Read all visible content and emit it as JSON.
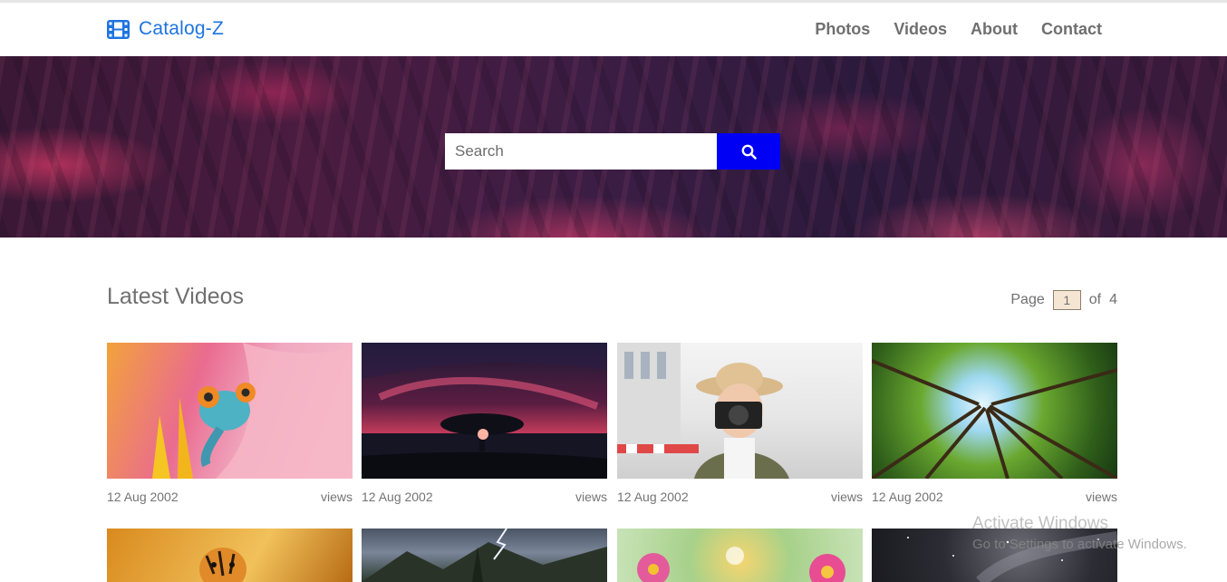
{
  "brand": {
    "name": "Catalog-Z",
    "icon": "film-icon",
    "color": "#1e74e0"
  },
  "nav": {
    "items": [
      {
        "label": "Photos"
      },
      {
        "label": "Videos"
      },
      {
        "label": "About"
      },
      {
        "label": "Contact"
      }
    ]
  },
  "hero": {
    "search": {
      "placeholder": "Search",
      "value": ""
    },
    "button_icon": "search-icon",
    "button_color": "#0000f5"
  },
  "section": {
    "title": "Latest Videos"
  },
  "pager": {
    "page_label": "Page",
    "current": "1",
    "of_label": "of",
    "total": "4"
  },
  "videos": [
    {
      "date": "12 Aug 2002",
      "views": "views",
      "image": "chameleon-on-flower"
    },
    {
      "date": "12 Aug 2002",
      "views": "views",
      "image": "tree-silhouette-sunset"
    },
    {
      "date": "12 Aug 2002",
      "views": "views",
      "image": "woman-with-camera"
    },
    {
      "date": "12 Aug 2002",
      "views": "views",
      "image": "forest-canopy"
    },
    {
      "image": "tiger"
    },
    {
      "image": "mountain-lightning"
    },
    {
      "image": "flowers"
    },
    {
      "image": "night-sky"
    }
  ],
  "watermark": {
    "title": "Activate Windows",
    "subtitle": "Go to Settings to activate Windows."
  }
}
